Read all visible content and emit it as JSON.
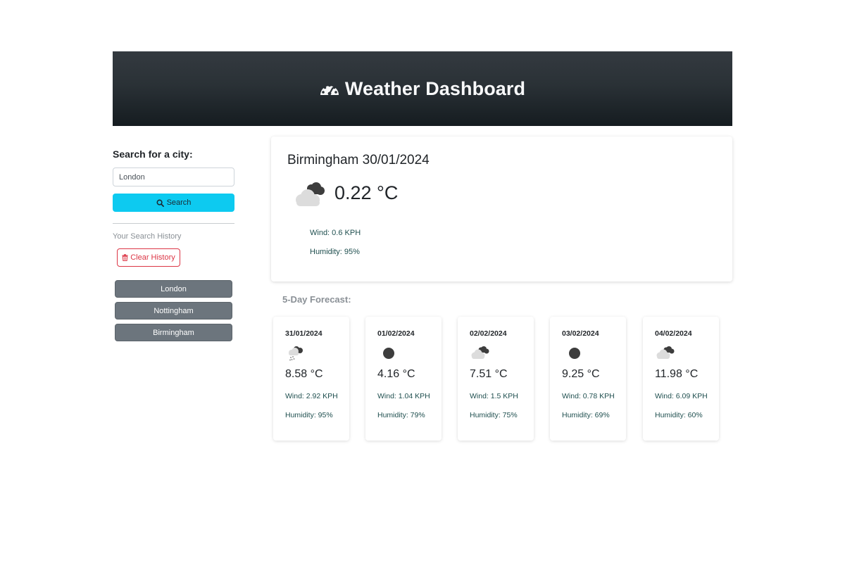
{
  "header": {
    "title": "Weather Dashboard",
    "icon": "gauge-icon"
  },
  "sidebar": {
    "search_label": "Search for a city:",
    "search_value": "London",
    "search_button": "Search",
    "history_label": "Your Search History",
    "clear_button": "Clear History",
    "history": [
      {
        "label": "London"
      },
      {
        "label": "Nottingham"
      },
      {
        "label": "Birmingham"
      }
    ]
  },
  "current": {
    "title": "Birmingham 30/01/2024",
    "icon": "broken-clouds-icon",
    "temp": "0.22 °C",
    "wind": "Wind: 0.6 KPH",
    "humidity": "Humidity: 95%"
  },
  "forecast_heading": "5-Day Forecast:",
  "forecast": [
    {
      "date": "31/01/2024",
      "icon": "rain-cloud-icon",
      "temp": "8.58 °C",
      "wind": "Wind: 2.92 KPH",
      "humidity": "Humidity: 95%"
    },
    {
      "date": "01/02/2024",
      "icon": "clear-icon",
      "temp": "4.16 °C",
      "wind": "Wind: 1.04 KPH",
      "humidity": "Humidity: 79%"
    },
    {
      "date": "02/02/2024",
      "icon": "broken-clouds-icon",
      "temp": "7.51 °C",
      "wind": "Wind: 1.5 KPH",
      "humidity": "Humidity: 75%"
    },
    {
      "date": "03/02/2024",
      "icon": "clear-icon",
      "temp": "9.25 °C",
      "wind": "Wind: 0.78 KPH",
      "humidity": "Humidity: 69%"
    },
    {
      "date": "04/02/2024",
      "icon": "broken-clouds-icon",
      "temp": "11.98 °C",
      "wind": "Wind: 6.09 KPH",
      "humidity": "Humidity: 60%"
    }
  ],
  "colors": {
    "search_button": "#0dcaf0",
    "clear_button": "#dc3545",
    "history_button": "#6c757d",
    "header_bg": "#212529"
  }
}
